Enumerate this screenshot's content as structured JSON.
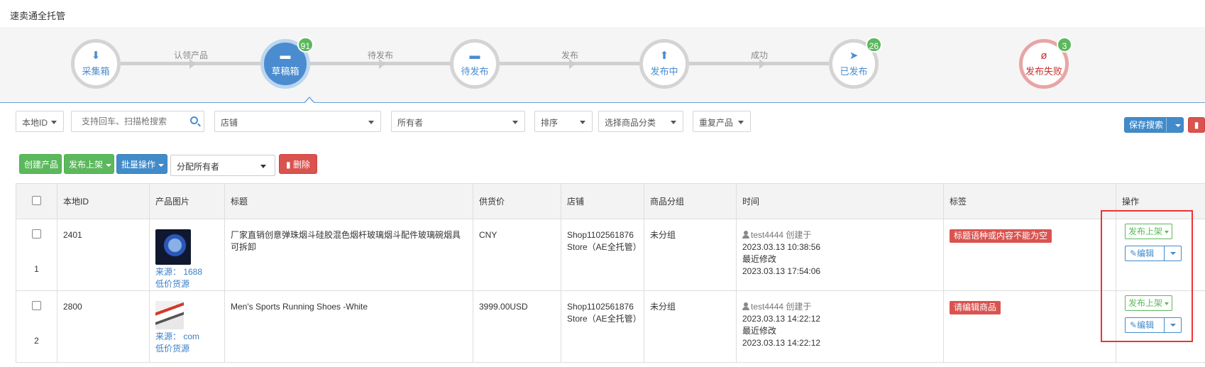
{
  "app": {
    "title": "速卖通全托管"
  },
  "steps": {
    "items": [
      {
        "label": "采集箱",
        "icon": "download-icon",
        "badge": ""
      },
      {
        "label": "草稿箱",
        "icon": "folder-icon",
        "badge": "91"
      },
      {
        "label": "待发布",
        "icon": "folder-icon",
        "badge": ""
      },
      {
        "label": "发布中",
        "icon": "upload-icon",
        "badge": ""
      },
      {
        "label": "已发布",
        "icon": "send-icon",
        "badge": "26"
      },
      {
        "label": "发布失败",
        "icon": "eye-slash-icon",
        "badge": "3"
      }
    ],
    "transitions": [
      "认领产品",
      "待发布",
      "发布",
      "成功"
    ]
  },
  "filters": {
    "local_id": "本地ID",
    "search_placeholder": "支持回车、扫描枪搜索",
    "shop": "店铺",
    "owner": "所有者",
    "sort": "排序",
    "category": "选择商品分类",
    "duplicate": "重复产品",
    "save_search": "保存搜索"
  },
  "toolbar": {
    "create": "创建产品",
    "publish": "发布上架",
    "batch": "批量操作",
    "assign_owner": "分配所有者",
    "delete": "删除"
  },
  "table": {
    "headers": [
      "本地ID",
      "产品图片",
      "标题",
      "供货价",
      "店铺",
      "商品分组",
      "时间",
      "标签",
      "操作"
    ],
    "rows": [
      {
        "num": "1",
        "local_id": "2401",
        "source": "来源： 1688",
        "low_price": "低价货源",
        "title": "厂家直销创意弹珠烟斗硅胶混色烟杆玻璃烟斗配件玻璃碗烟具可拆卸",
        "price": "CNY",
        "shop": "Shop1102561876 Store（AE全托管）",
        "group": "未分组",
        "user": "test4444",
        "created_label": "创建于",
        "created": "2023.03.13 10:38:56",
        "modified_label": "最近修改",
        "modified": "2023.03.13 17:54:06",
        "tag": "标题语种或内容不能为空",
        "publish": "发布上架",
        "edit": "编辑"
      },
      {
        "num": "2",
        "local_id": "2800",
        "source": "来源： com",
        "low_price": "低价货源",
        "title": "Men's Sports Running Shoes -White",
        "price": "3999.00USD",
        "shop": "Shop1102561876 Store（AE全托管）",
        "group": "未分组",
        "user": "test4444",
        "created_label": "创建于",
        "created": "2023.03.13 14:22:12",
        "modified_label": "最近修改",
        "modified": "2023.03.13 14:22:12",
        "tag": "请编辑商品",
        "publish": "发布上架",
        "edit": "编辑"
      }
    ]
  },
  "colors": {
    "accent_blue": "#428bca",
    "green": "#5cb85c",
    "red": "#d9534f",
    "highlight": "#e33333"
  }
}
